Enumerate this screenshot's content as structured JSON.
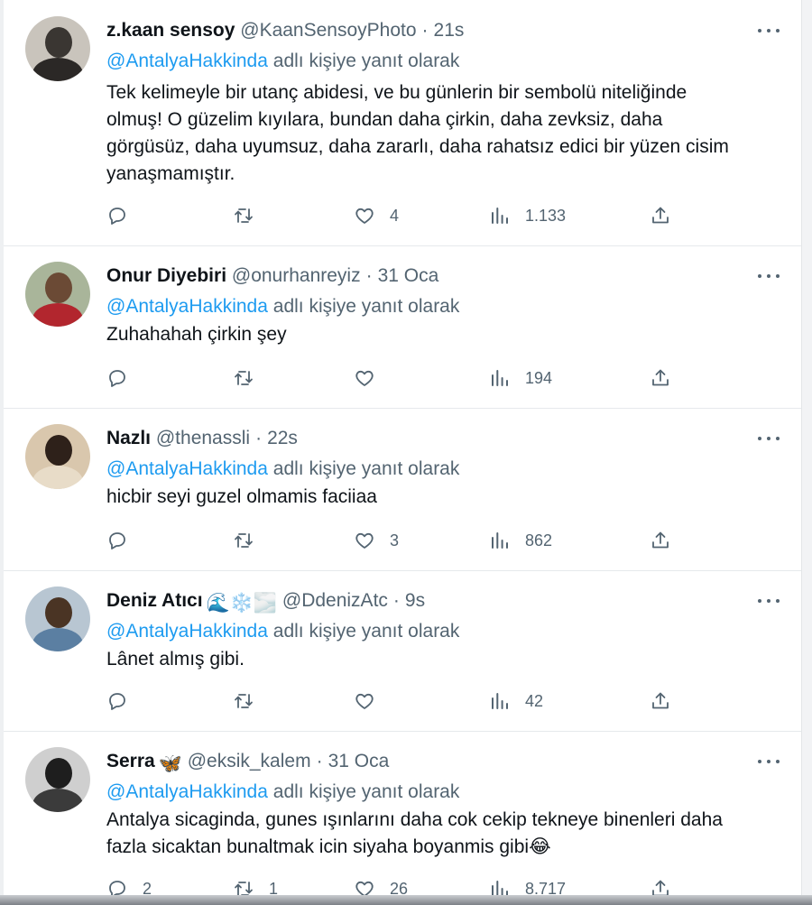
{
  "tweets": [
    {
      "name": "z.kaan sensoy",
      "handle": "@KaanSensoyPhoto",
      "time": "21s",
      "reply_to": "@AntalyaHakkinda",
      "reply_suffix": "adlı kişiye yanıt olarak",
      "lines": [
        "Tek kelimeyle bir utanç abidesi, ve bu günlerin bir sembolü niteliğinde",
        "olmuş! O güzelim kıyılara, bundan daha çirkin, daha zevksiz, daha",
        "görgüsüz, daha uyumsuz, daha zararlı, daha rahatsız edici bir yüzen cisim",
        "yanaşmamıştır."
      ],
      "replies": "",
      "retweets": "",
      "likes": "4",
      "views": "1.133"
    },
    {
      "name": "Onur Diyebiri",
      "handle": "@onurhanreyiz",
      "time": "31 Oca",
      "reply_to": "@AntalyaHakkinda",
      "reply_suffix": "adlı kişiye yanıt olarak",
      "lines": [
        "Zuhahahah çirkin şey"
      ],
      "replies": "",
      "retweets": "",
      "likes": "",
      "views": "194"
    },
    {
      "name": "Nazlı",
      "handle": "@thenassli",
      "time": "22s",
      "reply_to": "@AntalyaHakkinda",
      "reply_suffix": "adlı kişiye yanıt olarak",
      "lines": [
        "hicbir seyi guzel olmamis faciiaa"
      ],
      "replies": "",
      "retweets": "",
      "likes": "3",
      "views": "862"
    },
    {
      "name": "Deniz Atıcı",
      "name_emojis": "🌊❄️🌫️",
      "handle": "@DdenizAtc",
      "time": "9s",
      "reply_to": "@AntalyaHakkinda",
      "reply_suffix": "adlı kişiye yanıt olarak",
      "lines": [
        "Lânet almış gibi."
      ],
      "replies": "",
      "retweets": "",
      "likes": "",
      "views": "42"
    },
    {
      "name": "Serra",
      "name_emojis": "🦋",
      "handle": "@eksik_kalem",
      "time": "31 Oca",
      "reply_to": "@AntalyaHakkinda",
      "reply_suffix": "adlı kişiye yanıt olarak",
      "lines": [
        "Antalya sicaginda, gunes ışınlarını  daha cok cekip tekneye binenleri daha",
        "fazla sicaktan bunaltmak icin siyaha boyanmis gibi😂"
      ],
      "replies": "2",
      "retweets": "1",
      "likes": "26",
      "views": "8.717"
    }
  ],
  "icons": {
    "reply": "reply-icon",
    "retweet": "retweet-icon",
    "like": "heart-icon",
    "views": "views-icon",
    "share": "share-icon",
    "more": "more-icon"
  },
  "colors": {
    "mention": "#1d9bf0",
    "secondary_text": "#536471",
    "primary_text": "#0f1419"
  }
}
